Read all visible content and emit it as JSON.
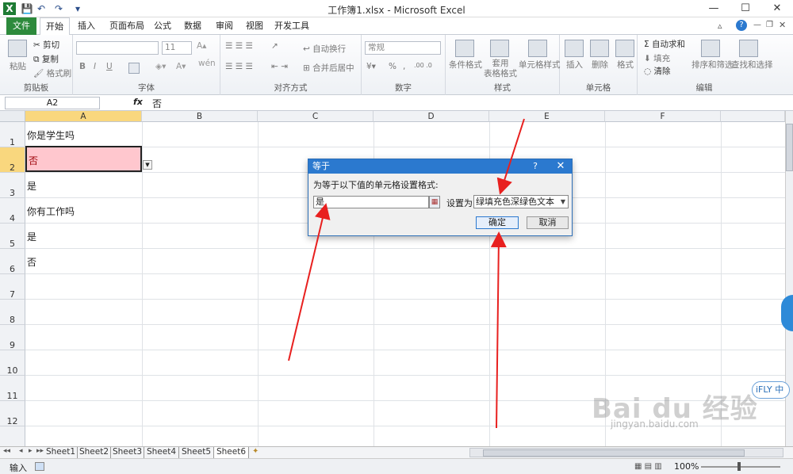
{
  "window": {
    "title": "工作簿1.xlsx - Microsoft Excel",
    "controls": [
      "—",
      "☐",
      "✕"
    ],
    "app_icon": "X"
  },
  "ribbon_tabs": [
    "文件",
    "开始",
    "插入",
    "页面布局",
    "公式",
    "数据",
    "审阅",
    "视图",
    "开发工具"
  ],
  "ribbon": {
    "clipboard": {
      "paste": "粘贴",
      "cut": "剪切",
      "copy": "复制",
      "painter": "格式刷",
      "label": "剪贴板"
    },
    "font": {
      "size": "11",
      "bold": "B",
      "italic": "I",
      "underline": "U",
      "label": "字体",
      "wen": "wén"
    },
    "align": {
      "wrap": "自动换行",
      "merge": "合并后居中",
      "label": "对齐方式"
    },
    "number": {
      "format": "常规",
      "percent": "%",
      "comma": ",",
      "label": "数字"
    },
    "styles": {
      "cond": "条件格式",
      "table": "套用\n表格格式",
      "cell_style": "单元格样式",
      "label": "样式"
    },
    "cells": {
      "insert": "插入",
      "delete": "删除",
      "format": "格式",
      "label": "单元格"
    },
    "editing": {
      "autosum": "Σ 自动求和",
      "fill": "填充",
      "clear": "清除",
      "sort": "排序和筛选",
      "find": "查找和选择",
      "label": "编辑"
    }
  },
  "formula_bar": {
    "name_box": "A2",
    "fx": "fx",
    "value": "否"
  },
  "columns": [
    "A",
    "B",
    "C",
    "D",
    "E",
    "F"
  ],
  "rows": [
    "1",
    "2",
    "3",
    "4",
    "5",
    "6",
    "7",
    "8",
    "9",
    "10",
    "11",
    "12"
  ],
  "cells": {
    "A1": "你是学生吗",
    "A2": "否",
    "A3": "是",
    "A4": "你有工作吗",
    "A5": "是",
    "A6": "否"
  },
  "sheet_tabs": [
    "Sheet1",
    "Sheet2",
    "Sheet3",
    "Sheet4",
    "Sheet5",
    "Sheet6"
  ],
  "active_sheet": "Sheet6",
  "status": {
    "mode": "输入",
    "zoom": "100%"
  },
  "dialog": {
    "title": "等于",
    "help": "?",
    "close": "✕",
    "prompt": "为等于以下值的单元格设置格式:",
    "input_value": "是",
    "set_as_label": "设置为",
    "format_option": "绿填充色深绿色文本",
    "ok": "确定",
    "cancel": "取消"
  },
  "overlay": {
    "ifly": "iFLY 中",
    "watermark": "Bai du 经验",
    "watermark_url": "jingyan.baidu.com"
  },
  "colors": {
    "accent": "#2b79cf",
    "file_tab": "#2d8a3c",
    "selected_cell_fill": "#ffc7ce",
    "selected_cell_text": "#9c0006",
    "arrow": "#e8201f"
  }
}
